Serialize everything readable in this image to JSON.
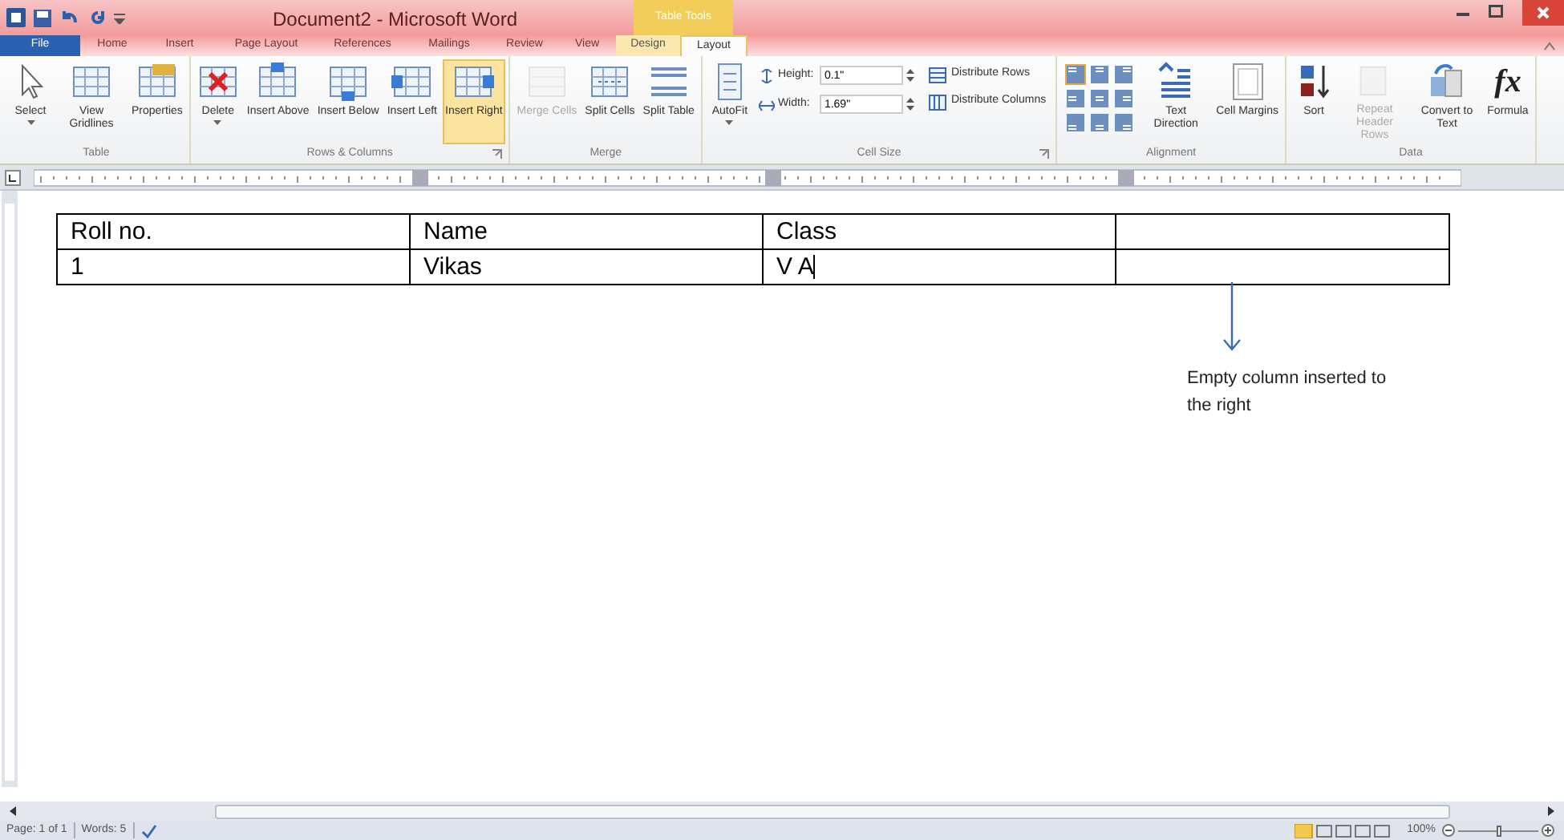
{
  "title_bar": {
    "title": "Document2 - Microsoft Word",
    "context_group": "Table Tools"
  },
  "tabs": [
    {
      "label": "File",
      "kind": "file",
      "selected": false
    },
    {
      "label": "Home",
      "kind": "normal",
      "selected": false
    },
    {
      "label": "Insert",
      "kind": "normal",
      "selected": false
    },
    {
      "label": "Page Layout",
      "kind": "normal",
      "selected": false
    },
    {
      "label": "References",
      "kind": "normal",
      "selected": false
    },
    {
      "label": "Mailings",
      "kind": "normal",
      "selected": false
    },
    {
      "label": "Review",
      "kind": "normal",
      "selected": false
    },
    {
      "label": "View",
      "kind": "normal",
      "selected": false
    },
    {
      "label": "Design",
      "kind": "contextual",
      "selected": false
    },
    {
      "label": "Layout",
      "kind": "contextual",
      "selected": true
    }
  ],
  "ribbon_groups": [
    {
      "label": "Table",
      "items": [
        {
          "kind": "large",
          "label": "Select",
          "disabled": false,
          "selected": false,
          "dropdown": true
        },
        {
          "kind": "large",
          "label": "View Gridlines",
          "disabled": false,
          "selected": false,
          "dropdown": false
        },
        {
          "kind": "large",
          "label": "Properties",
          "disabled": false,
          "selected": false,
          "dropdown": false
        }
      ]
    },
    {
      "label": "Rows & Columns",
      "launcher": true,
      "items": [
        {
          "kind": "large",
          "label": "Delete",
          "disabled": false,
          "selected": false,
          "dropdown": true
        },
        {
          "kind": "large",
          "label": "Insert Above",
          "disabled": false,
          "selected": false,
          "dropdown": false
        },
        {
          "kind": "large",
          "label": "Insert Below",
          "disabled": false,
          "selected": false,
          "dropdown": false
        },
        {
          "kind": "large",
          "label": "Insert Left",
          "disabled": false,
          "selected": false,
          "dropdown": false
        },
        {
          "kind": "large",
          "label": "Insert Right",
          "disabled": false,
          "selected": true,
          "dropdown": false
        }
      ]
    },
    {
      "label": "Merge",
      "items": [
        {
          "kind": "large",
          "label": "Merge Cells",
          "disabled": true,
          "selected": false,
          "dropdown": false
        },
        {
          "kind": "large",
          "label": "Split Cells",
          "disabled": false,
          "selected": false,
          "dropdown": false
        },
        {
          "kind": "large",
          "label": "Split Table",
          "disabled": false,
          "selected": false,
          "dropdown": false
        }
      ]
    },
    {
      "label": "Cell Size",
      "launcher": true,
      "items": [
        {
          "kind": "large",
          "label": "AutoFit",
          "disabled": false,
          "selected": false,
          "dropdown": true
        },
        {
          "kind": "spinners",
          "fields": [
            {
              "label": "Height:",
              "value": "0.1\""
            },
            {
              "label": "Width:",
              "value": "1.69\""
            }
          ]
        },
        {
          "kind": "small_stack",
          "buttons": [
            {
              "label": "Distribute Rows"
            },
            {
              "label": "Distribute Columns"
            }
          ]
        }
      ]
    },
    {
      "label": "Alignment",
      "items": [
        {
          "kind": "align_grid",
          "cells": [
            {
              "selected": true
            },
            {
              "selected": false
            },
            {
              "selected": false
            },
            {
              "selected": false
            },
            {
              "selected": false
            },
            {
              "selected": false
            },
            {
              "selected": false
            },
            {
              "selected": false
            },
            {
              "selected": false
            }
          ]
        },
        {
          "kind": "large",
          "label": "Text Direction",
          "disabled": false,
          "selected": false,
          "dropdown": false
        },
        {
          "kind": "large",
          "label": "Cell Margins",
          "disabled": false,
          "selected": false,
          "dropdown": false
        }
      ]
    },
    {
      "label": "Data",
      "items": [
        {
          "kind": "large",
          "label": "Sort",
          "disabled": false,
          "selected": false,
          "dropdown": false
        },
        {
          "kind": "large",
          "label": "Repeat Header Rows",
          "disabled": true,
          "selected": false,
          "dropdown": false
        },
        {
          "kind": "large",
          "label": "Convert to Text",
          "disabled": false,
          "selected": false,
          "dropdown": false
        },
        {
          "kind": "large",
          "label": "Formula",
          "glyph": "fx",
          "disabled": false,
          "selected": false,
          "dropdown": false
        }
      ]
    }
  ],
  "table": {
    "rows": [
      [
        "Roll no.",
        "Name",
        "Class",
        ""
      ],
      [
        "1",
        "Vikas",
        "V A",
        ""
      ]
    ]
  },
  "annotation": "Empty column inserted to the right",
  "status_bar": {
    "page": "Page: 1 of 1",
    "words": "Words: 5",
    "zoom": "100%",
    "zoom_slider": {
      "level": 0.5
    }
  }
}
